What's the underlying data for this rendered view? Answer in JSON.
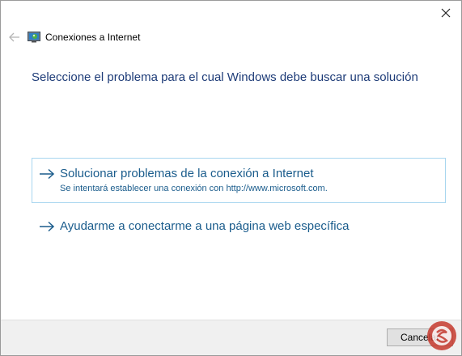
{
  "window": {
    "title": "Conexiones a Internet"
  },
  "heading": "Seleccione el problema para el cual Windows debe buscar una solución",
  "options": [
    {
      "title": "Solucionar problemas de la conexión a Internet",
      "subtitle": "Se intentará establecer una conexión con http://www.microsoft.com."
    },
    {
      "title": "Ayudarme a conectarme a una página web específica"
    }
  ],
  "footer": {
    "cancel_label": "Cancelar"
  },
  "icons": {
    "close": "close-icon",
    "back": "back-arrow-icon",
    "app": "network-internet-icon",
    "option_arrow": "arrow-right-icon"
  },
  "colors": {
    "heading": "#1e3c78",
    "link": "#1a5c8c",
    "selected_border": "#a8d6ef",
    "footer_bg": "#f0f0f0"
  }
}
